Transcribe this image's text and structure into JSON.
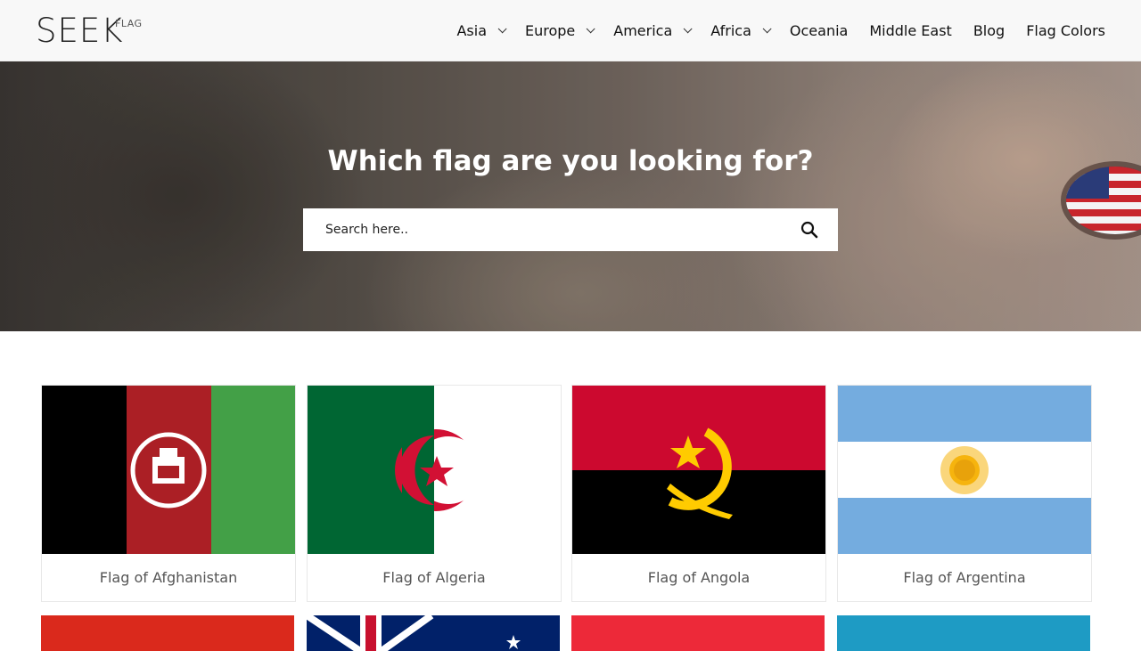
{
  "logo": {
    "main": "SEEK",
    "sub": "FLAG"
  },
  "nav": {
    "items": [
      {
        "label": "Asia",
        "dropdown": true
      },
      {
        "label": "Europe",
        "dropdown": true
      },
      {
        "label": "America",
        "dropdown": true
      },
      {
        "label": "Africa",
        "dropdown": true
      },
      {
        "label": "Oceania",
        "dropdown": false
      },
      {
        "label": "Middle East",
        "dropdown": false
      },
      {
        "label": "Blog",
        "dropdown": false
      },
      {
        "label": "Flag Colors",
        "dropdown": false
      }
    ]
  },
  "hero": {
    "title": "Which flag are you looking for?",
    "search_placeholder": "Search here..",
    "search_icon": "search-icon"
  },
  "flags": [
    {
      "caption": "Flag of Afghanistan",
      "colors": [
        "#000000",
        "#ab1f25",
        "#43a047"
      ]
    },
    {
      "caption": "Flag of Algeria",
      "colors": [
        "#006633",
        "#ffffff",
        "#d21034"
      ]
    },
    {
      "caption": "Flag of Angola",
      "colors": [
        "#cc092f",
        "#000000",
        "#ffcb00"
      ]
    },
    {
      "caption": "Flag of Argentina",
      "colors": [
        "#74acdf",
        "#ffffff",
        "#f6b40e"
      ]
    }
  ],
  "colors": {
    "header_bg": "#f8f8f8",
    "text": "#111111",
    "caption": "#555555"
  }
}
